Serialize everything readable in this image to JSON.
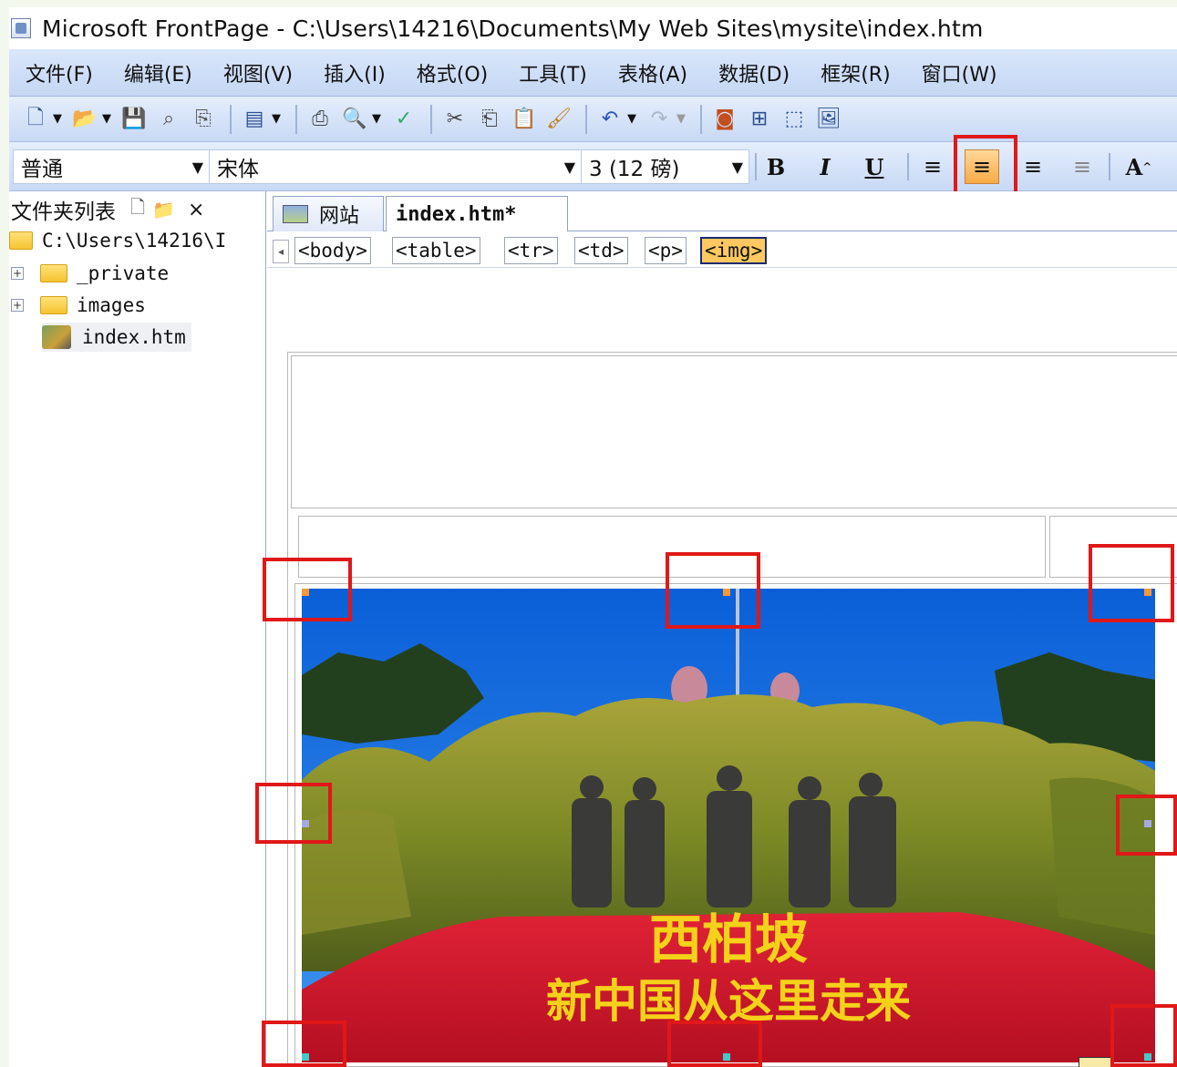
{
  "window": {
    "title": "Microsoft FrontPage - C:\\Users\\14216\\Documents\\My Web Sites\\mysite\\index.htm"
  },
  "menu": [
    "文件(F)",
    "编辑(E)",
    "视图(V)",
    "插入(I)",
    "格式(O)",
    "工具(T)",
    "表格(A)",
    "数据(D)",
    "框架(R)",
    "窗口(W)"
  ],
  "formatting": {
    "style": "普通",
    "font": "宋体",
    "size": "3 (12 磅)",
    "bold": "B",
    "italic": "I",
    "underline": "U",
    "font_grow": "A",
    "active_alignment": "center"
  },
  "folder_panel": {
    "title": "文件夹列表",
    "close": "×",
    "root": "C:\\Users\\14216\\I",
    "items": [
      "_private",
      "images",
      "index.htm"
    ]
  },
  "tabs": {
    "site": "网站",
    "page": "index.htm*"
  },
  "tags": [
    "<body>",
    "<table>",
    "<tr>",
    "<td>",
    "<p>",
    "<img>"
  ],
  "photo": {
    "caption_line1": "西柏坡",
    "caption_line2": "新中国从这里走来"
  },
  "colors": {
    "menubar": "#c5d7f4",
    "active_button": "#f7a944",
    "selected_tag": "#ffc860",
    "highlight_box": "#e01818",
    "sky": "#1c6fe0",
    "flowers": "#d9182c",
    "lettering": "#f5d21a"
  }
}
